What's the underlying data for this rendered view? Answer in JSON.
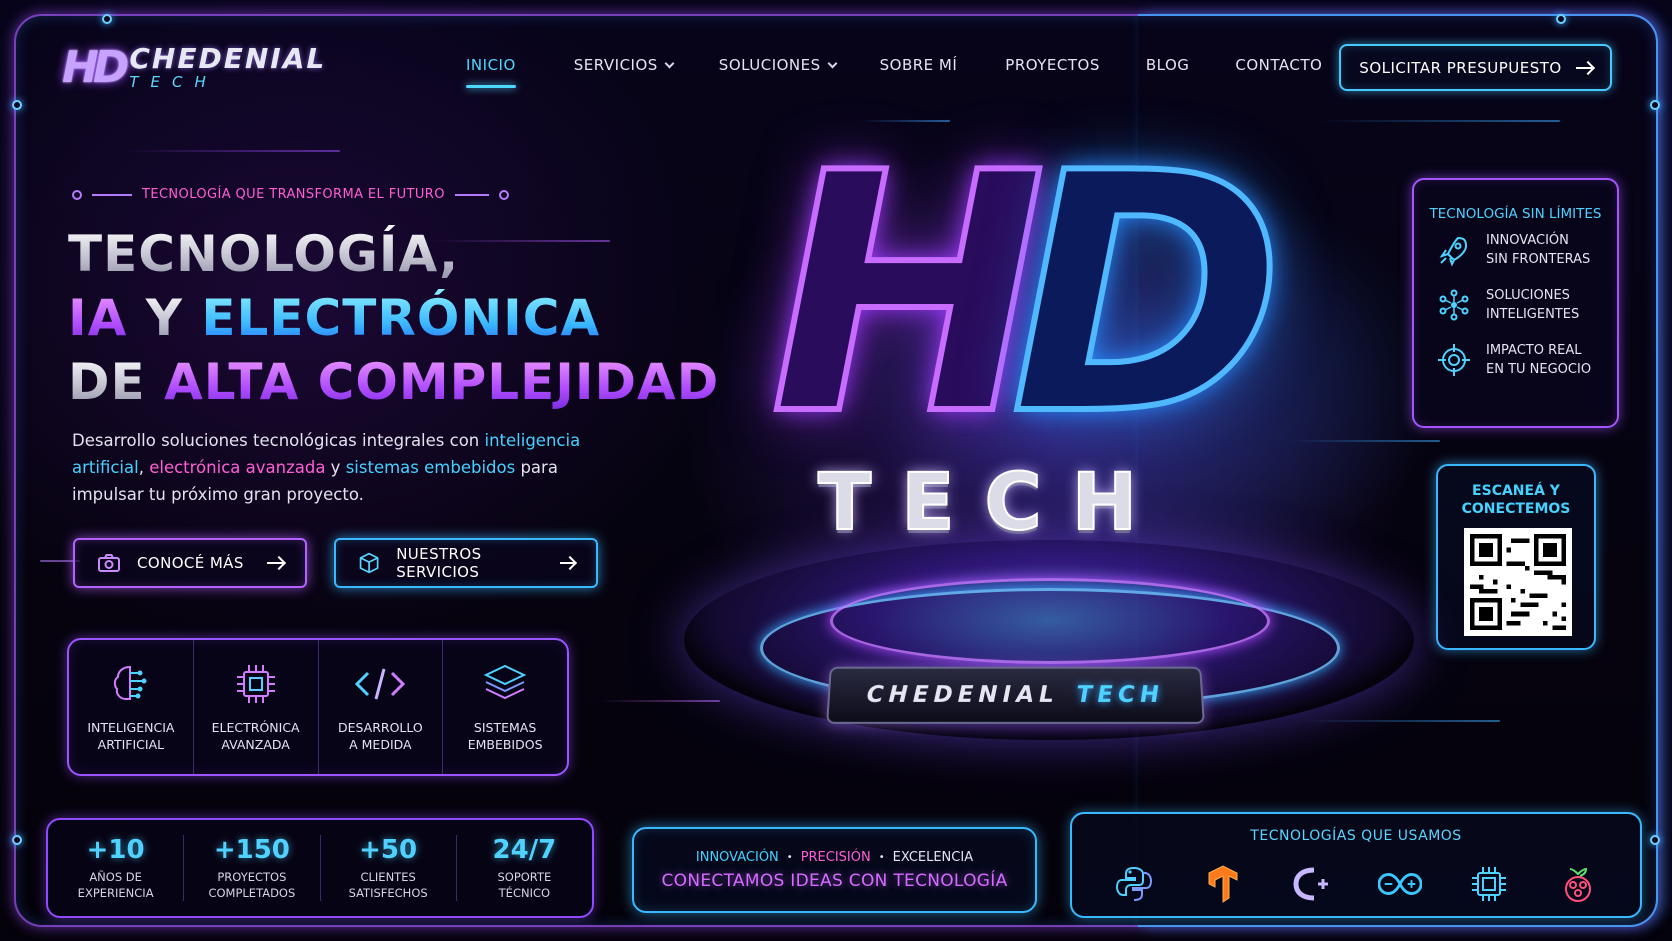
{
  "brand": {
    "mark": "HD",
    "name": "CHEDENIAL",
    "sub": "TECH"
  },
  "nav": {
    "items": [
      {
        "label": "INICIO",
        "active": true,
        "dropdown": false
      },
      {
        "label": "SERVICIOS",
        "active": false,
        "dropdown": true
      },
      {
        "label": "SOLUCIONES",
        "active": false,
        "dropdown": true
      },
      {
        "label": "SOBRE MÍ",
        "active": false,
        "dropdown": false
      },
      {
        "label": "PROYECTOS",
        "active": false,
        "dropdown": false
      },
      {
        "label": "BLOG",
        "active": false,
        "dropdown": false
      },
      {
        "label": "CONTACTO",
        "active": false,
        "dropdown": false
      }
    ],
    "cta": "SOLICITAR PRESUPUESTO"
  },
  "hero": {
    "tagline": "TECNOLOGÍA QUE TRANSFORMA EL FUTURO",
    "headline": {
      "line1": "TECNOLOGÍA,",
      "line2_a": "IA",
      "line2_b": " Y ",
      "line2_c": "ELECTRÓNICA",
      "line3_a": "DE ",
      "line3_b": "ALTA COMPLEJIDAD"
    },
    "description": {
      "p1": "Desarrollo soluciones tecnológicas integrales con ",
      "hl1": "inteligencia artificial",
      "p2": ", ",
      "hl2": "electrónica",
      "p3": " ",
      "hl3": "avanzada",
      "p4": " y ",
      "hl4": "sistemas embebidos",
      "p5": " para impulsar tu próximo gran proyecto."
    },
    "buttons": {
      "primary": "CONOCÉ MÁS",
      "secondary": "NUESTROS SERVICIOS"
    },
    "art": {
      "mark_h": "H",
      "mark_d": "D",
      "word": "TECH",
      "plate_a": "CHEDENIAL",
      "plate_b": "TECH"
    }
  },
  "services": [
    {
      "icon": "brain-circuit-icon",
      "label": "INTELIGENCIA\nARTIFICIAL"
    },
    {
      "icon": "chip-icon",
      "label": "ELECTRÓNICA\nAVANZADA"
    },
    {
      "icon": "code-icon",
      "label": "DESARROLLO\nA MEDIDA"
    },
    {
      "icon": "layers-icon",
      "label": "SISTEMAS\nEMBEBIDOS"
    }
  ],
  "stats": [
    {
      "value": "+10",
      "label": "AÑOS DE\nEXPERIENCIA"
    },
    {
      "value": "+150",
      "label": "PROYECTOS\nCOMPLETADOS"
    },
    {
      "value": "+50",
      "label": "CLIENTES\nSATISFECHOS"
    },
    {
      "value": "24/7",
      "label": "SOPORTE\nTÉCNICO"
    }
  ],
  "banner": {
    "w1": "INNOVACIÓN",
    "w2": "PRECISIÓN",
    "w3": "EXCELENCIA",
    "sep": "•",
    "main": "CONECTAMOS IDEAS CON TECNOLOGÍA"
  },
  "techs": {
    "title": "TECNOLOGÍAS QUE USAMOS",
    "icons": [
      "python-icon",
      "tensorflow-icon",
      "cplusplus-icon",
      "arduino-icon",
      "microchip-icon",
      "raspberry-pi-icon"
    ]
  },
  "side_panel": {
    "title": "TECNOLOGÍA SIN LÍMITES",
    "items": [
      {
        "icon": "rocket-icon",
        "label": "INNOVACIÓN\nSIN FRONTERAS"
      },
      {
        "icon": "network-icon",
        "label": "SOLUCIONES\nINTELIGENTES"
      },
      {
        "icon": "target-icon",
        "label": "IMPACTO REAL\nEN TU NEGOCIO"
      }
    ]
  },
  "qr": {
    "title": "ESCANEÁ Y\nCONECTEMOS"
  },
  "colors": {
    "accent_cyan": "#4fd2ff",
    "accent_purple": "#b462ff",
    "accent_pink": "#ff5fd6",
    "background": "#05030c"
  }
}
